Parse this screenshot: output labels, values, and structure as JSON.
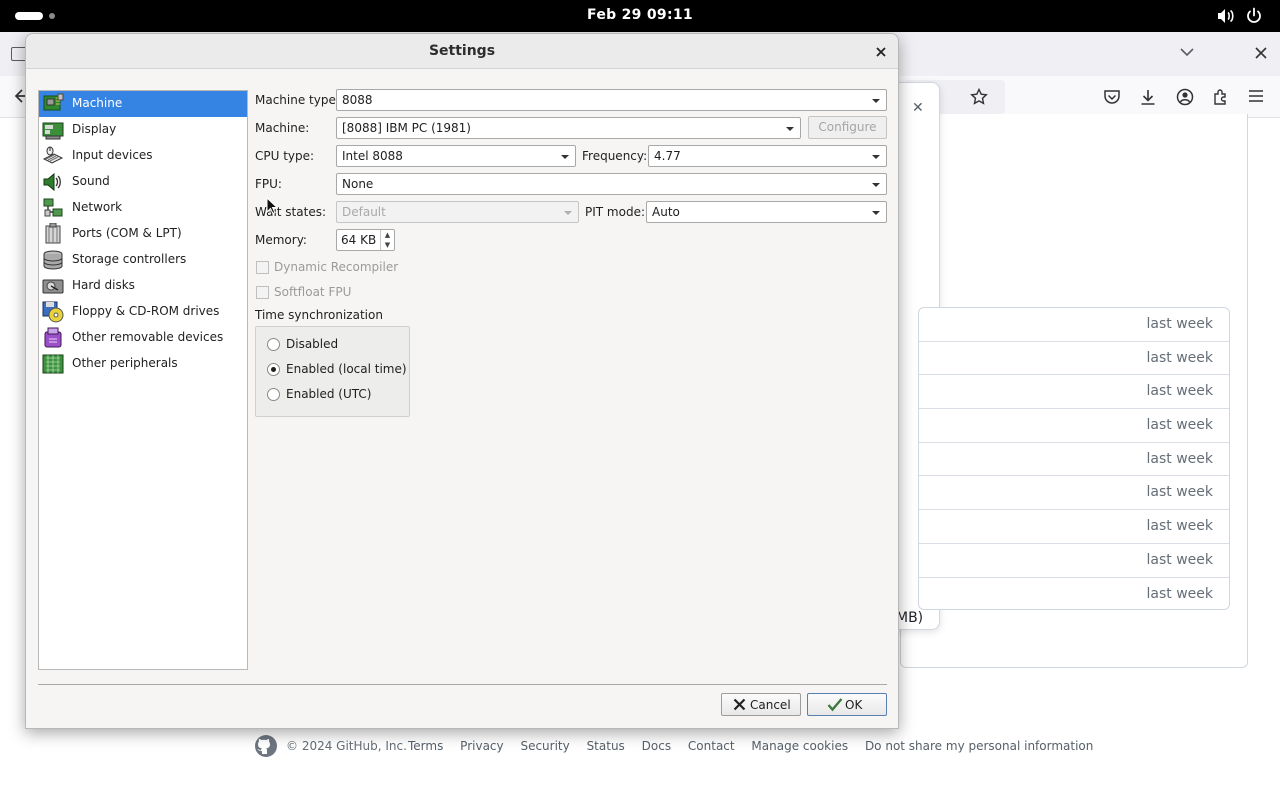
{
  "topbar": {
    "clock": "Feb 29  09:11"
  },
  "browser": {
    "file_dates": [
      "last week",
      "last week",
      "last week",
      "last week",
      "last week",
      "last week",
      "last week",
      "last week",
      "last week"
    ],
    "popover_size_text": "MB)",
    "footer": {
      "copyright": "© 2024 GitHub, Inc.",
      "links": [
        "Terms",
        "Privacy",
        "Security",
        "Status",
        "Docs",
        "Contact",
        "Manage cookies",
        "Do not share my personal information"
      ]
    }
  },
  "dialog": {
    "title": "Settings",
    "categories": [
      {
        "label": "Machine",
        "icon": "machine-icon",
        "selected": true
      },
      {
        "label": "Display",
        "icon": "display-icon"
      },
      {
        "label": "Input devices",
        "icon": "input-devices-icon"
      },
      {
        "label": "Sound",
        "icon": "sound-icon"
      },
      {
        "label": "Network",
        "icon": "network-icon"
      },
      {
        "label": "Ports (COM & LPT)",
        "icon": "ports-icon"
      },
      {
        "label": "Storage controllers",
        "icon": "storage-controllers-icon"
      },
      {
        "label": "Hard disks",
        "icon": "hard-disk-icon"
      },
      {
        "label": "Floppy & CD-ROM drives",
        "icon": "floppy-cdrom-icon"
      },
      {
        "label": "Other removable devices",
        "icon": "removable-devices-icon"
      },
      {
        "label": "Other peripherals",
        "icon": "peripherals-icon"
      }
    ],
    "machine_type": {
      "label": "Machine type:",
      "value": "8088"
    },
    "machine": {
      "label": "Machine:",
      "value": "[8088] IBM PC (1981)",
      "configure": "Configure"
    },
    "cpu_type": {
      "label": "CPU type:",
      "value": "Intel 8088"
    },
    "frequency": {
      "label": "Frequency:",
      "value": "4.77"
    },
    "fpu": {
      "label": "FPU:",
      "value": "None"
    },
    "wait_states": {
      "label": "Wait states:",
      "value": "Default"
    },
    "pit_mode": {
      "label": "PIT mode:",
      "value": "Auto"
    },
    "memory": {
      "label": "Memory:",
      "value": "64 KB"
    },
    "dynamic_recompiler": "Dynamic Recompiler",
    "softfloat_fpu": "Softfloat FPU",
    "time_sync": {
      "label": "Time synchronization",
      "options": [
        "Disabled",
        "Enabled (local time)",
        "Enabled (UTC)"
      ],
      "selected": "Enabled (local time)"
    },
    "cancel": "Cancel",
    "ok": "OK"
  }
}
